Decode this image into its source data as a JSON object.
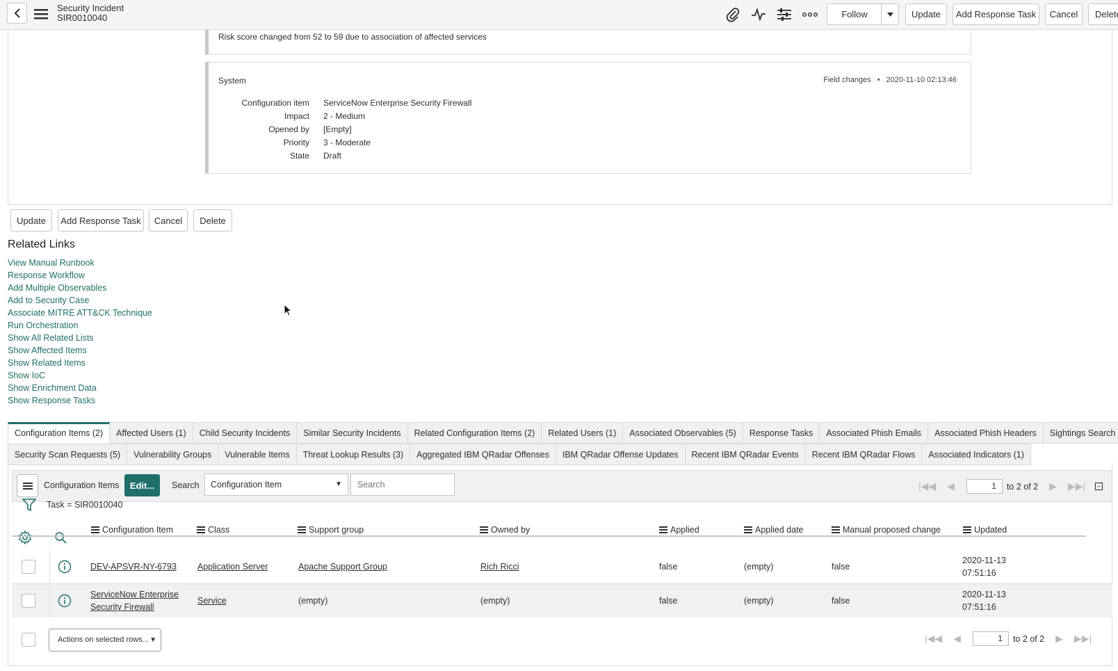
{
  "header": {
    "title_line1": "Security Incident",
    "title_line2": "SIR0010040",
    "follow_label": "Follow",
    "update_label": "Update",
    "add_task_label": "Add Response Task",
    "cancel_label": "Cancel",
    "delete_label": "Delete"
  },
  "activity": {
    "risk_text": "Risk score changed from 52 to 59 due to association of affected services",
    "source": "System",
    "meta_type": "Field changes",
    "meta_dot": "•",
    "meta_time": "2020-11-10 02:13:46",
    "fields": [
      {
        "label": "Configuration item",
        "value": "ServiceNow Enterprise Security Firewall"
      },
      {
        "label": "Impact",
        "value": "2 - Medium"
      },
      {
        "label": "Opened by",
        "value": "[Empty]"
      },
      {
        "label": "Priority",
        "value": "3 - Moderate"
      },
      {
        "label": "State",
        "value": "Draft"
      }
    ]
  },
  "buttons": {
    "update": "Update",
    "add_task": "Add Response Task",
    "cancel": "Cancel",
    "delete": "Delete"
  },
  "related_links": {
    "title": "Related Links",
    "items": [
      "View Manual Runbook",
      "Response Workflow",
      "Add Multiple Observables",
      "Add to Security Case",
      "Associate MITRE ATT&CK Technique",
      "Run Orchestration",
      "Show All Related Lists",
      "Show Affected Items",
      "Show Related Items",
      "Show IoC",
      "Show Enrichment Data",
      "Show Response Tasks"
    ]
  },
  "tabs_row1": [
    "Configuration Items (2)",
    "Affected Users (1)",
    "Child Security Incidents",
    "Similar Security Incidents",
    "Related Configuration Items (2)",
    "Related Users (1)",
    "Associated Observables (5)",
    "Response Tasks",
    "Associated Phish Emails",
    "Associated Phish Headers",
    "Sightings Search Details"
  ],
  "tabs_row2": [
    "Security Scan Requests (5)",
    "Vulnerability Groups",
    "Vulnerable Items",
    "Threat Lookup Results (3)",
    "Aggregated IBM QRadar Offenses",
    "IBM QRadar Offense Updates",
    "Recent IBM QRadar Events",
    "Recent IBM QRadar Flows",
    "Associated Indicators (1)"
  ],
  "list": {
    "title": "Configuration Items",
    "edit_label": "Edit...",
    "search_label": "Search",
    "search_field": "Configuration Item",
    "search_placeholder": "Search",
    "page": "1",
    "page_total": "to 2 of 2",
    "filter": "Task = SIR0010040",
    "columns": [
      "Configuration Item",
      "Class",
      "Support group",
      "Owned by",
      "Applied",
      "Applied date",
      "Manual proposed change",
      "Updated"
    ],
    "rows": [
      {
        "ci_line1": "DEV-APSVR-NY-6793",
        "ci_line2": "",
        "class": "Application Server",
        "support_group": "Apache Support Group",
        "owned_by": "Rich Ricci",
        "applied": "false",
        "applied_date": "(empty)",
        "manual": "false",
        "updated_date": "2020-11-13",
        "updated_time": "07:51:16"
      },
      {
        "ci_line1": "ServiceNow Enterprise",
        "ci_line2": "Security Firewall",
        "class": "Service",
        "support_group": "(empty)",
        "owned_by": "(empty)",
        "applied": "false",
        "applied_date": "(empty)",
        "manual": "false",
        "updated_date": "2020-11-13",
        "updated_time": "07:51:16"
      }
    ],
    "actions_label": "Actions on selected rows..."
  },
  "colors": {
    "accent": "#1f6f6a",
    "link": "#1f6f6a",
    "header_bg": "#f4f5f6"
  }
}
